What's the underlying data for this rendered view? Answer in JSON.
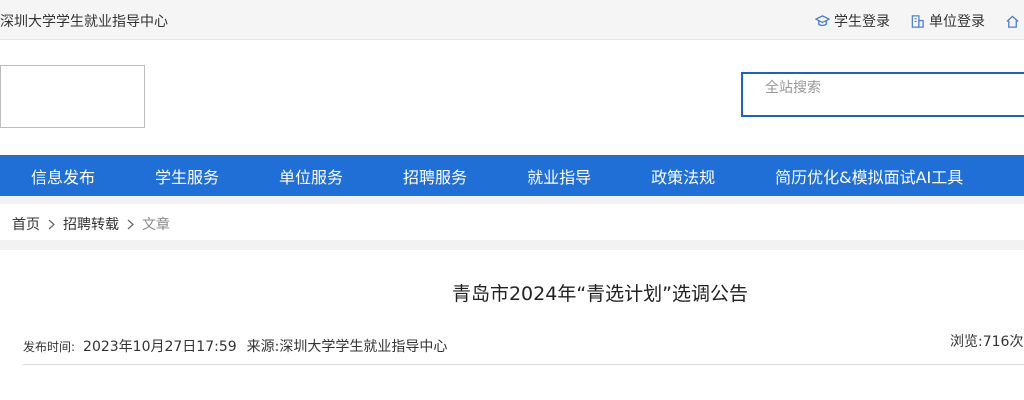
{
  "topbar": {
    "site_name": "深圳大学学生就业指导中心",
    "links": [
      {
        "label": "学生登录",
        "icon": "graduation-cap-icon"
      },
      {
        "label": "单位登录",
        "icon": "building-icon"
      },
      {
        "label": "",
        "icon": "home-icon"
      }
    ]
  },
  "search": {
    "placeholder": "全站搜索"
  },
  "nav": {
    "items": [
      "信息发布",
      "学生服务",
      "单位服务",
      "招聘服务",
      "就业指导",
      "政策法规",
      "简历优化&模拟面试AI工具"
    ]
  },
  "breadcrumb": {
    "items": [
      "首页",
      "招聘转载",
      "文章"
    ]
  },
  "article": {
    "title": "青岛市2024年“青选计划”选调公告",
    "publish_label": "发布时间:",
    "publish_time": "2023年10月27日17:59",
    "source_label": "来源:",
    "source": "深圳大学学生就业指导中心",
    "views_label": "浏览:",
    "views": "716次"
  },
  "colors": {
    "nav_bg": "#1f6fd6",
    "search_border": "#1f5fc9",
    "topbar_bg": "#f5f5f5"
  }
}
